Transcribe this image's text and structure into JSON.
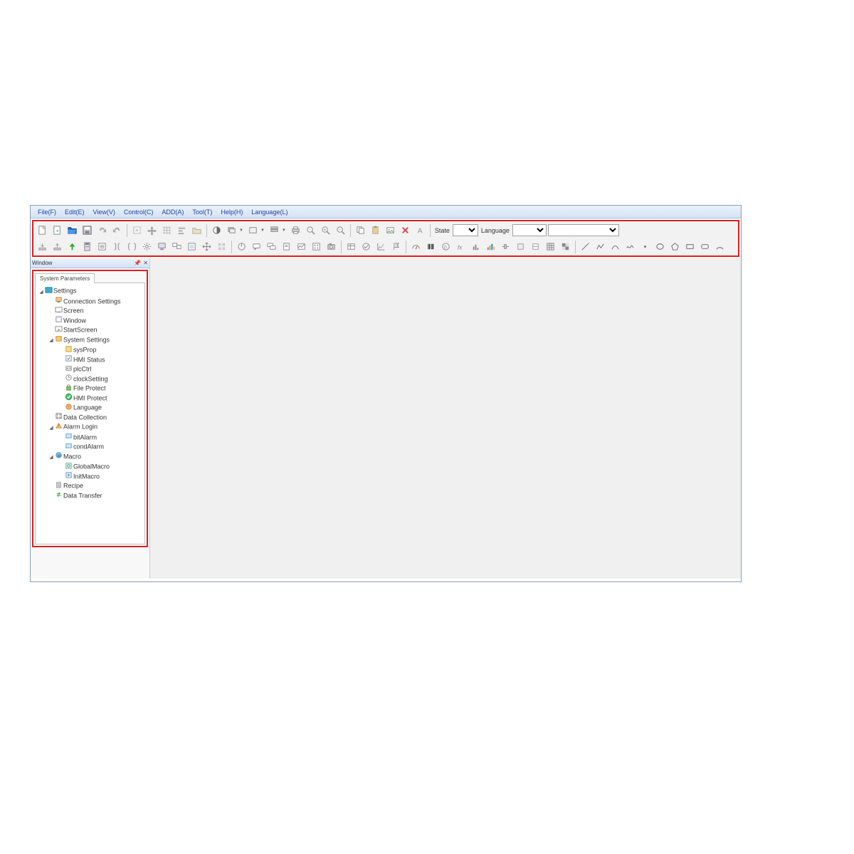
{
  "menu": {
    "items": [
      "File(F)",
      "Edit(E)",
      "View(V)",
      "Control(C)",
      "ADD(A)",
      "Tool(T)",
      "Help(H)",
      "Language(L)"
    ]
  },
  "toolbar": {
    "state_label": "State",
    "language_label": "Language",
    "state_value": "",
    "language_value": "",
    "extra_value": ""
  },
  "sidebar": {
    "title": "Window",
    "tab_label": "System Parameters"
  },
  "tree": {
    "settings": "Settings",
    "connection": "Connection Settings",
    "screen": "Screen",
    "window": "Window",
    "startscreen": "StartScreen",
    "system_settings": "System Settings",
    "sysprop": "sysProp",
    "hmistatus": "HMI Status",
    "plcctrl": "plcCtrl",
    "clocksetting": "clockSetting",
    "fileprotect": "File Protect",
    "hmiprotect": "HMI Protect",
    "language": "Language",
    "datacollection": "Data Collection",
    "alarmlogin": "Alarm Login",
    "bitalarm": "bitAlarm",
    "condalarm": "condAlarm",
    "macro": "Macro",
    "globalmacro": "GlobalMacro",
    "initmacro": "InitMacro",
    "recipe": "Recipe",
    "datatransfer": "Data Transfer"
  }
}
